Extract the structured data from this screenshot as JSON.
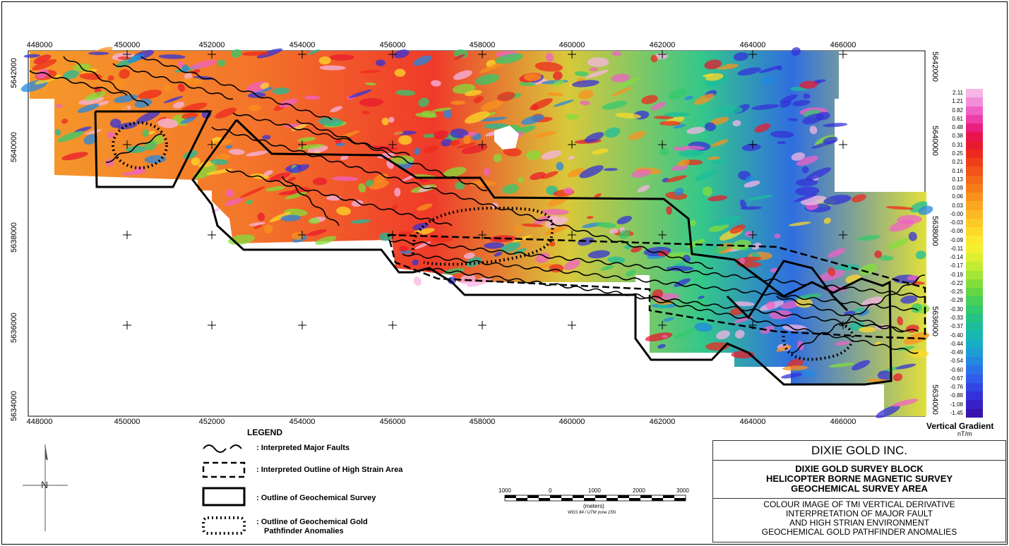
{
  "map": {
    "x_ticks": [
      "448000",
      "450000",
      "452000",
      "454000",
      "456000",
      "458000",
      "460000",
      "462000",
      "464000",
      "466000"
    ],
    "y_ticks": [
      "5642000",
      "5640000",
      "5638000",
      "5636000",
      "5634000"
    ]
  },
  "legend": {
    "title": "LEGEND",
    "items": [
      {
        "label": ": Interpreted Major Faults"
      },
      {
        "label": ": Interpreted Outline of High Strain Area"
      },
      {
        "label": ": Outline of Geochemical Survey"
      },
      {
        "label": ": Outline of Geochemical Gold",
        "label2": "Pathfinder Anomalies"
      }
    ]
  },
  "scalebar": {
    "labels": [
      "1000",
      "0",
      "1000",
      "2000",
      "3000"
    ],
    "units": "(meters)",
    "projection": "WGS 84 / UTM zone 15N"
  },
  "colorbar": {
    "title": "Vertical Gradient",
    "units": "nT/m",
    "values": [
      "2.11",
      "1.21",
      "0.82",
      "0.61",
      "0.48",
      "0.38",
      "0.31",
      "0.25",
      "0.21",
      "0.16",
      "0.13",
      "0.09",
      "0.06",
      "0.03",
      "-0.00",
      "-0.03",
      "-0.06",
      "-0.09",
      "-0.11",
      "-0.14",
      "-0.17",
      "-0.19",
      "-0.22",
      "-0.25",
      "-0.28",
      "-0.30",
      "-0.33",
      "-0.37",
      "-0.40",
      "-0.44",
      "-0.49",
      "-0.54",
      "-0.60",
      "-0.67",
      "-0.76",
      "-0.88",
      "-1.08",
      "-1.45"
    ],
    "colors": [
      "#f7b6e6",
      "#f28fd9",
      "#f062c6",
      "#ee3fa8",
      "#ea1f7f",
      "#e8154d",
      "#e81a2e",
      "#ec2a1e",
      "#ef3f1a",
      "#f25318",
      "#f46818",
      "#f77d1a",
      "#f9921d",
      "#fba621",
      "#fcb824",
      "#fdc927",
      "#fed92a",
      "#fde82d",
      "#f4f02f",
      "#dcef31",
      "#c2ec33",
      "#a4e637",
      "#83de3c",
      "#63d646",
      "#48cf57",
      "#33c96d",
      "#24c384",
      "#1bbd9b",
      "#18b7b2",
      "#19acc6",
      "#1d9dd6",
      "#2388e0",
      "#2a72e6",
      "#2f5ce8",
      "#3245e3",
      "#3431d8",
      "#3620c6",
      "#3a12ad"
    ]
  },
  "titleblock": {
    "company": "DIXIE GOLD INC.",
    "line1": "DIXIE GOLD SURVEY BLOCK",
    "line2": "HELICOPTER BORNE MAGNETIC SURVEY",
    "line3": "GEOCHEMICAL SURVEY AREA",
    "note1": "COLOUR IMAGE OF TMI VERTICAL DERIVATIVE",
    "note2": "INTERPRETATION OF MAJOR FAULT",
    "note3": "AND HIGH STRIAN ENVIRONMENT",
    "note4": "GEOCHEMICAL GOLD PATHFINDER ANOMALIES"
  }
}
